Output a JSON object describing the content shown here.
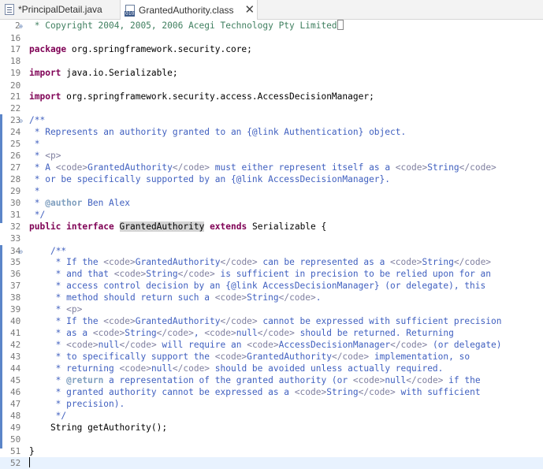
{
  "tabs": [
    {
      "label": "*PrincipalDetail.java",
      "icon": "java-file-icon",
      "active": false
    },
    {
      "label": "GrantedAuthority.class",
      "icon": "class-file-icon",
      "active": true,
      "close": "✕"
    }
  ],
  "lines": [
    {
      "n": "2",
      "fold": "⊕",
      "html": "<span class=\"cm\"> * Copyright 2004, 2005, 2006 Acegi Technology Pty Limited</span><span class=\"box\"></span>"
    },
    {
      "n": "16",
      "html": ""
    },
    {
      "n": "17",
      "html": "<span class=\"kw\">package</span> org.springframework.security.core;"
    },
    {
      "n": "18",
      "html": ""
    },
    {
      "n": "19",
      "html": "<span class=\"kw\">import</span> java.io.Serializable;"
    },
    {
      "n": "20",
      "html": ""
    },
    {
      "n": "21",
      "html": "<span class=\"kw\">import</span> org.springframework.security.access.AccessDecisionManager;"
    },
    {
      "n": "22",
      "html": ""
    },
    {
      "n": "23",
      "fold": "⊖",
      "html": "<span class=\"jd\">/**</span>"
    },
    {
      "n": "24",
      "html": "<span class=\"jd\"> * Represents an authority granted to an {@link Authentication} object.</span>"
    },
    {
      "n": "25",
      "html": "<span class=\"jd\"> *</span>"
    },
    {
      "n": "26",
      "html": "<span class=\"jd\"> * </span><span class=\"tag\">&lt;p&gt;</span>"
    },
    {
      "n": "27",
      "html": "<span class=\"jd\"> * A </span><span class=\"tag\">&lt;code&gt;</span><span class=\"jd\">GrantedAuthority</span><span class=\"tag\">&lt;/code&gt;</span><span class=\"jd\"> must either represent itself as a </span><span class=\"tag\">&lt;code&gt;</span><span class=\"jd\">String</span><span class=\"tag\">&lt;/code&gt;</span>"
    },
    {
      "n": "28",
      "html": "<span class=\"jd\"> * or be specifically supported by an {@link AccessDecisionManager}.</span>"
    },
    {
      "n": "29",
      "html": "<span class=\"jd\"> *</span>"
    },
    {
      "n": "30",
      "html": "<span class=\"jd\"> * </span><span class=\"at\">@author</span><span class=\"jd\"> Ben Alex</span>"
    },
    {
      "n": "31",
      "html": "<span class=\"jd\"> */</span>"
    },
    {
      "n": "32",
      "html": "<span class=\"kw\">public interface</span> <span class=\"hl\">GrantedAuthority</span> <span class=\"kw\">extends</span> Serializable {"
    },
    {
      "n": "33",
      "html": ""
    },
    {
      "n": "34",
      "fold": "⊖",
      "html": "    <span class=\"jd\">/**</span>"
    },
    {
      "n": "35",
      "html": "<span class=\"jd\">     * If the </span><span class=\"tag\">&lt;code&gt;</span><span class=\"jd\">GrantedAuthority</span><span class=\"tag\">&lt;/code&gt;</span><span class=\"jd\"> can be represented as a </span><span class=\"tag\">&lt;code&gt;</span><span class=\"jd\">String</span><span class=\"tag\">&lt;/code&gt;</span>"
    },
    {
      "n": "36",
      "html": "<span class=\"jd\">     * and that </span><span class=\"tag\">&lt;code&gt;</span><span class=\"jd\">String</span><span class=\"tag\">&lt;/code&gt;</span><span class=\"jd\"> is sufficient in precision to be relied upon for an</span>"
    },
    {
      "n": "37",
      "html": "<span class=\"jd\">     * access control decision by an {@link AccessDecisionManager} (or delegate), this</span>"
    },
    {
      "n": "38",
      "html": "<span class=\"jd\">     * method should return such a </span><span class=\"tag\">&lt;code&gt;</span><span class=\"jd\">String</span><span class=\"tag\">&lt;/code&gt;</span><span class=\"jd\">.</span>"
    },
    {
      "n": "39",
      "html": "<span class=\"jd\">     * </span><span class=\"tag\">&lt;p&gt;</span>"
    },
    {
      "n": "40",
      "html": "<span class=\"jd\">     * If the </span><span class=\"tag\">&lt;code&gt;</span><span class=\"jd\">GrantedAuthority</span><span class=\"tag\">&lt;/code&gt;</span><span class=\"jd\"> cannot be expressed with sufficient precision</span>"
    },
    {
      "n": "41",
      "html": "<span class=\"jd\">     * as a </span><span class=\"tag\">&lt;code&gt;</span><span class=\"jd\">String</span><span class=\"tag\">&lt;/code&gt;</span><span class=\"jd\">, </span><span class=\"tag\">&lt;code&gt;</span><span class=\"jd\">null</span><span class=\"tag\">&lt;/code&gt;</span><span class=\"jd\"> should be returned. Returning</span>"
    },
    {
      "n": "42",
      "html": "<span class=\"jd\">     * </span><span class=\"tag\">&lt;code&gt;</span><span class=\"jd\">null</span><span class=\"tag\">&lt;/code&gt;</span><span class=\"jd\"> will require an </span><span class=\"tag\">&lt;code&gt;</span><span class=\"jd\">AccessDecisionManager</span><span class=\"tag\">&lt;/code&gt;</span><span class=\"jd\"> (or delegate)</span>"
    },
    {
      "n": "43",
      "html": "<span class=\"jd\">     * to specifically support the </span><span class=\"tag\">&lt;code&gt;</span><span class=\"jd\">GrantedAuthority</span><span class=\"tag\">&lt;/code&gt;</span><span class=\"jd\"> implementation, so</span>"
    },
    {
      "n": "44",
      "html": "<span class=\"jd\">     * returning </span><span class=\"tag\">&lt;code&gt;</span><span class=\"jd\">null</span><span class=\"tag\">&lt;/code&gt;</span><span class=\"jd\"> should be avoided unless actually required.</span>"
    },
    {
      "n": "45",
      "html": "<span class=\"jd\">     * </span><span class=\"at\">@return</span><span class=\"jd\"> a representation of the granted authority (or </span><span class=\"tag\">&lt;code&gt;</span><span class=\"jd\">null</span><span class=\"tag\">&lt;/code&gt;</span><span class=\"jd\"> if the</span>"
    },
    {
      "n": "46",
      "html": "<span class=\"jd\">     * granted authority cannot be expressed as a </span><span class=\"tag\">&lt;code&gt;</span><span class=\"jd\">String</span><span class=\"tag\">&lt;/code&gt;</span><span class=\"jd\"> with sufficient</span>"
    },
    {
      "n": "47",
      "html": "<span class=\"jd\">     * precision).</span>"
    },
    {
      "n": "48",
      "html": "<span class=\"jd\">     */</span>"
    },
    {
      "n": "49",
      "html": "    String getAuthority();"
    },
    {
      "n": "50",
      "html": ""
    },
    {
      "n": "51",
      "html": "}"
    },
    {
      "n": "52",
      "html": "<span class=\"caret\"></span>",
      "current": true
    }
  ]
}
